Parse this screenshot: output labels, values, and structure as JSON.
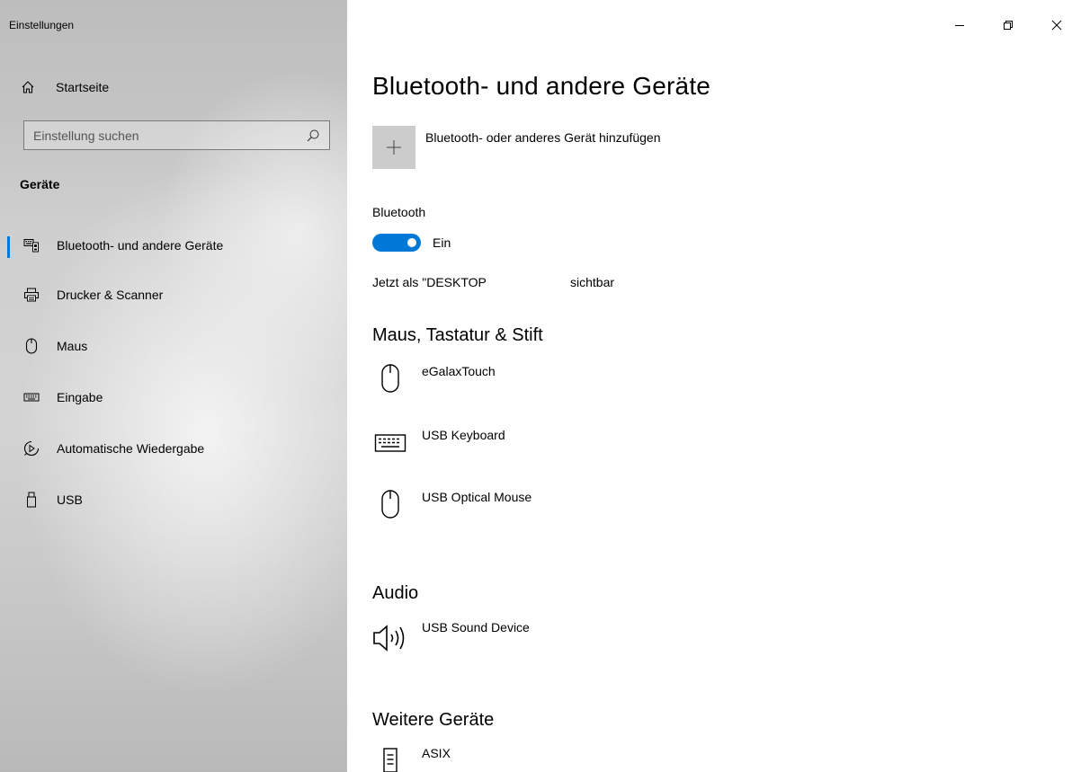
{
  "window": {
    "title": "Einstellungen"
  },
  "sidebar": {
    "home_label": "Startseite",
    "search_placeholder": "Einstellung suchen",
    "section_title": "Geräte",
    "items": [
      {
        "label": "Bluetooth- und andere Geräte",
        "icon": "bluetooth-devices-icon",
        "active": true
      },
      {
        "label": "Drucker & Scanner",
        "icon": "printer-icon"
      },
      {
        "label": "Maus",
        "icon": "mouse-icon"
      },
      {
        "label": "Eingabe",
        "icon": "keyboard-icon"
      },
      {
        "label": "Automatische Wiedergabe",
        "icon": "autoplay-icon"
      },
      {
        "label": "USB",
        "icon": "usb-icon"
      }
    ]
  },
  "main": {
    "title": "Bluetooth- und andere Geräte",
    "add_device_label": "Bluetooth- oder anderes Gerät hinzufügen",
    "bluetooth_label": "Bluetooth",
    "bluetooth_state": "Ein",
    "visible_prefix": "Jetzt als \"DESKTOP",
    "visible_suffix": "sichtbar",
    "groups": {
      "input": {
        "title": "Maus, Tastatur & Stift",
        "devices": [
          {
            "name": "eGalaxTouch",
            "icon": "mouse-icon"
          },
          {
            "name": "USB Keyboard",
            "icon": "keyboard-icon"
          },
          {
            "name": "USB Optical Mouse",
            "icon": "mouse-icon"
          }
        ]
      },
      "audio": {
        "title": "Audio",
        "devices": [
          {
            "name": "USB Sound Device",
            "icon": "speaker-icon"
          }
        ]
      },
      "other": {
        "title": "Weitere Geräte",
        "devices": [
          {
            "name": "ASIX",
            "icon": "network-adapter-icon"
          }
        ]
      }
    }
  },
  "colors": {
    "accent": "#0078d7",
    "add_button_bg": "#cccccc"
  }
}
